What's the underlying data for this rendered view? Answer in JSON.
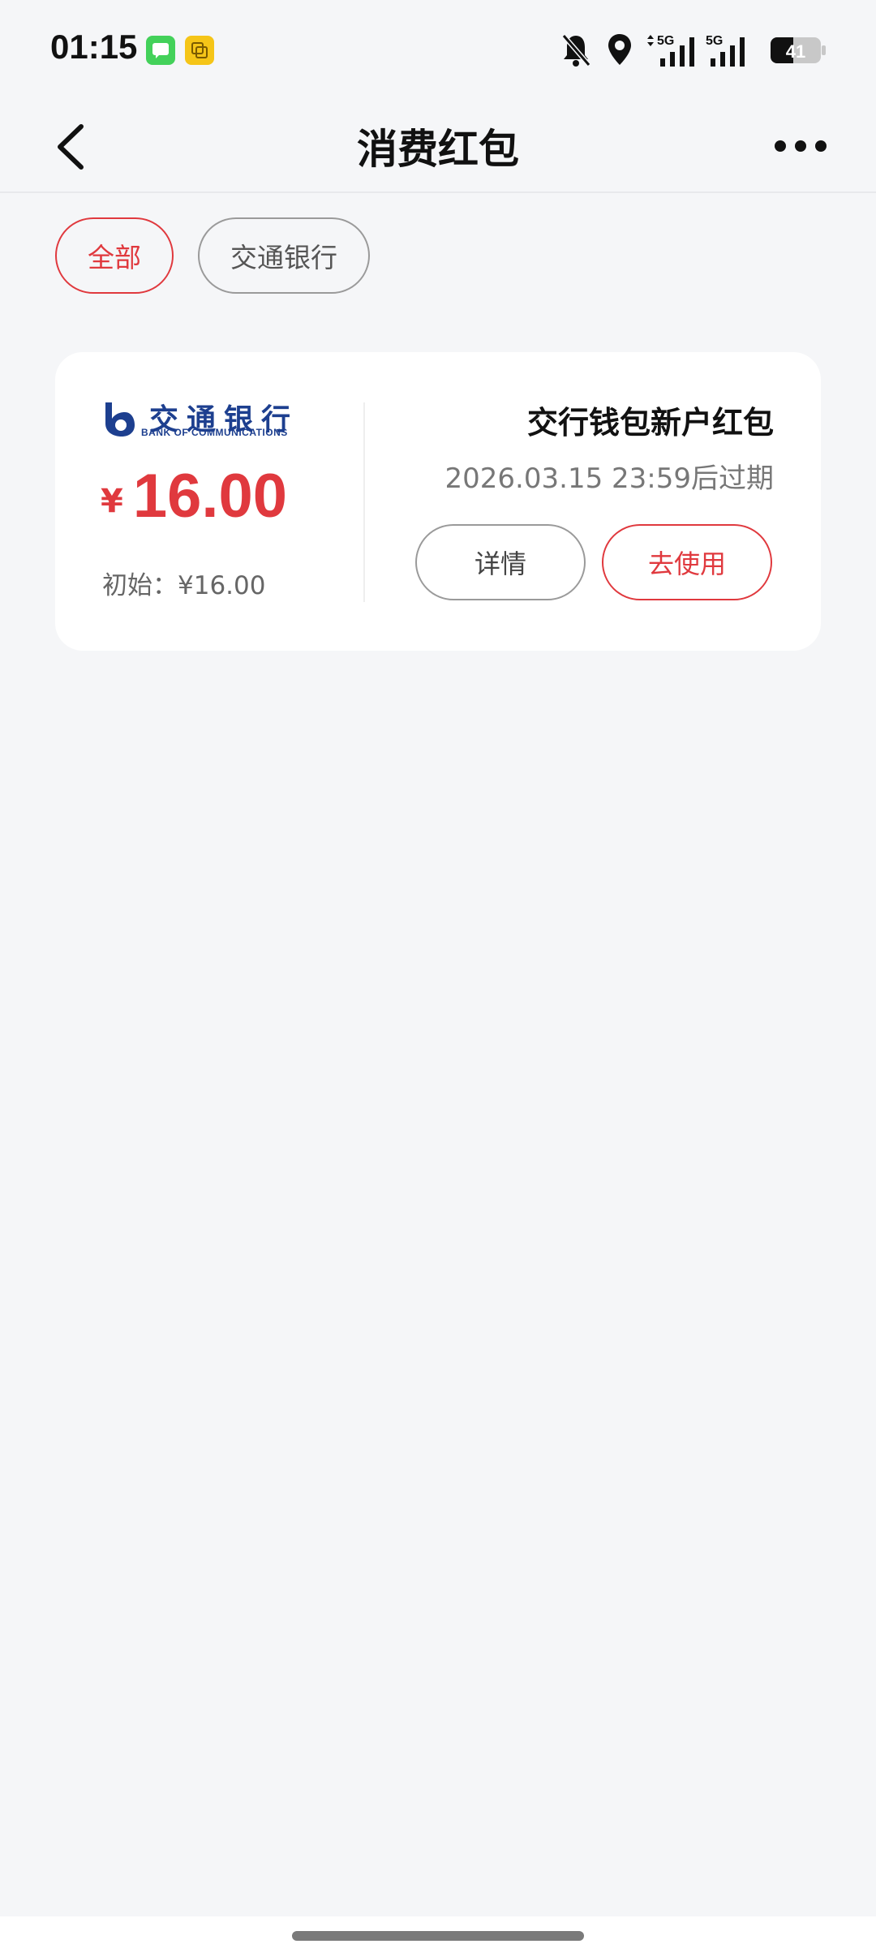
{
  "status_bar": {
    "time": "01:15",
    "icons": [
      "messages-app-icon",
      "notes-app-icon",
      "bell-muted-icon",
      "location-icon",
      "5g-signal-icon",
      "5g-signal-icon",
      "battery-icon"
    ],
    "signal_label_1": "5G",
    "signal_label_2": "5G",
    "battery_level": "41"
  },
  "nav": {
    "title": "消费红包"
  },
  "tabs": [
    {
      "label": "全部",
      "active": true
    },
    {
      "label": "交通银行",
      "active": false
    }
  ],
  "coupon": {
    "bank_name_cn": "交通银行",
    "bank_name_en": "BANK OF COMMUNICATIONS",
    "currency_symbol": "¥",
    "amount": "16.00",
    "initial_label": "初始：¥16.00",
    "title": "交行钱包新户红包",
    "expiry": "2026.03.15 23:59后过期",
    "detail_button": "详情",
    "use_button": "去使用"
  },
  "colors": {
    "accent": "#e0393e",
    "background": "#f5f6f8",
    "bank_blue": "#1d3f8f"
  }
}
